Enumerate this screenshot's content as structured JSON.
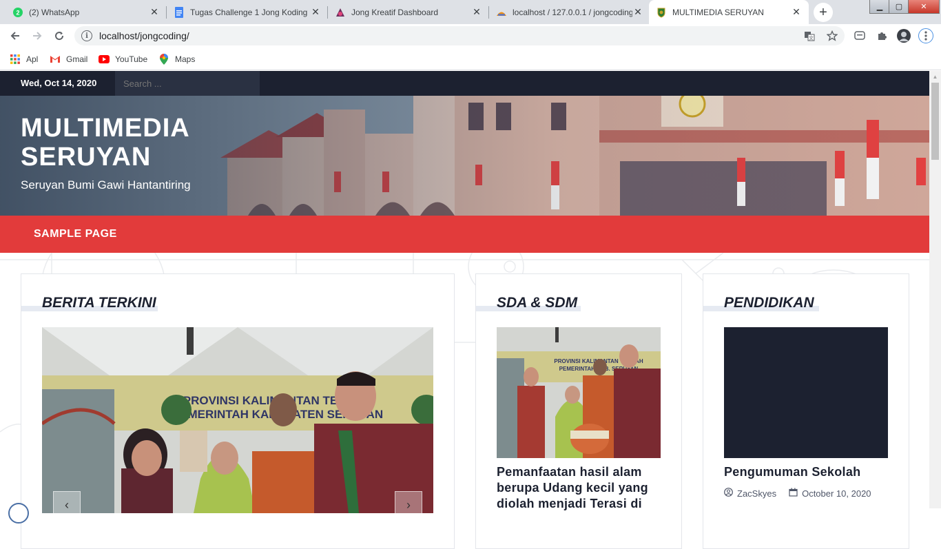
{
  "browser": {
    "tabs": [
      {
        "title": "(2) WhatsApp",
        "icon": "whatsapp-icon"
      },
      {
        "title": "Tugas Challenge 1 Jong Koding",
        "icon": "docs-icon"
      },
      {
        "title": "Jong Kreatif Dashboard",
        "icon": "dashboard-icon"
      },
      {
        "title": "localhost / 127.0.0.1 / jongcoding",
        "icon": "phpmyadmin-icon"
      },
      {
        "title": "MULTIMEDIA SERUYAN",
        "icon": "crest-icon"
      }
    ],
    "active_tab_index": 4,
    "url": "localhost/jongcoding/",
    "bookmarks": [
      {
        "label": "Apl",
        "icon": "apps-grid-icon"
      },
      {
        "label": "Gmail",
        "icon": "gmail-icon"
      },
      {
        "label": "YouTube",
        "icon": "youtube-icon"
      },
      {
        "label": "Maps",
        "icon": "maps-pin-icon"
      }
    ]
  },
  "site": {
    "date": "Wed, Oct 14, 2020",
    "search_placeholder": "Search ...",
    "title_line1": "MULTIMEDIA",
    "title_line2": "SERUYAN",
    "tagline": "Seruyan Bumi Gawi Hantantiring",
    "nav": [
      "SAMPLE PAGE"
    ]
  },
  "sections": {
    "berita": {
      "heading": "BERITA TERKINI",
      "banner_text_line1": "PROVINSI KALIMANTAN TENGAH",
      "banner_text_line2": "PEMERINTAH KABUPATEN SERUYAN"
    },
    "sdm": {
      "heading": "SDA & SDM",
      "post_title_line1": "Pemanfaatan hasil alam",
      "post_title_line2": "berupa Udang kecil yang",
      "post_title_line3": "diolah menjadi Terasi di"
    },
    "pendidikan": {
      "heading": "PENDIDIKAN",
      "post_title": "Pengumuman Sekolah",
      "author": "ZacSkyes",
      "date": "October 10, 2020"
    }
  },
  "colors": {
    "accent": "#e23b3b",
    "dark": "#1c2130"
  }
}
